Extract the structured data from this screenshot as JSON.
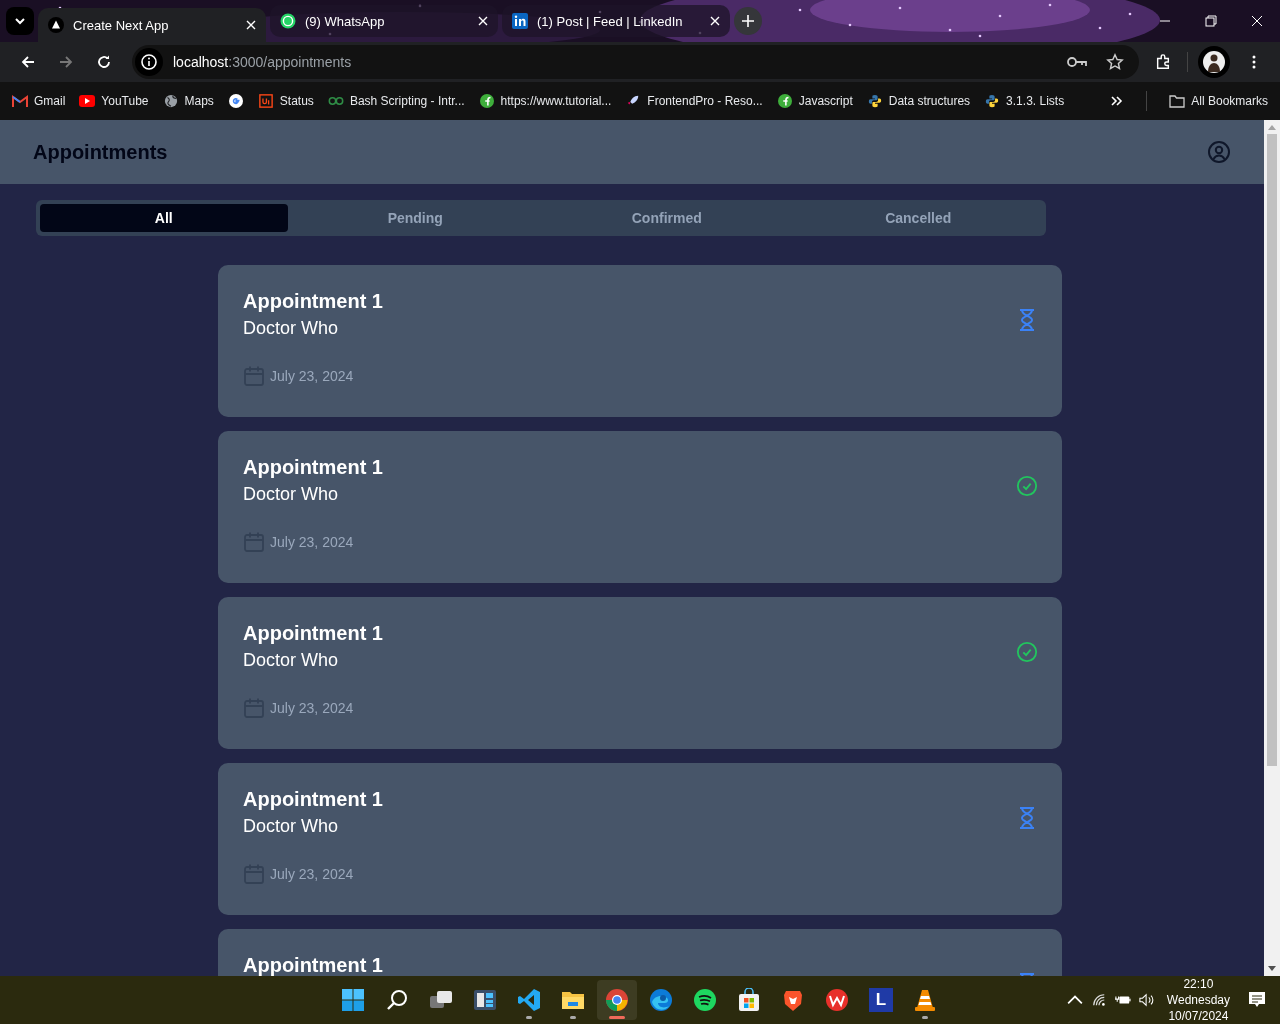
{
  "browser": {
    "tabs": [
      {
        "title": "Create Next App",
        "kind": "next",
        "selected": true
      },
      {
        "title": "(9) WhatsApp",
        "kind": "whatsapp",
        "selected": false
      },
      {
        "title": "(1) Post | Feed | LinkedIn",
        "kind": "linkedin",
        "selected": false
      }
    ],
    "address": {
      "host": "localhost",
      "path": ":3000/appointments"
    },
    "bookmarks": [
      {
        "label": "Gmail",
        "kind": "gmail"
      },
      {
        "label": "YouTube",
        "kind": "youtube"
      },
      {
        "label": "Maps",
        "kind": "globe"
      },
      {
        "kind": "google"
      },
      {
        "label": "Status",
        "kind": "ui"
      },
      {
        "label": "Bash Scripting - Intr...",
        "kind": "gfg"
      },
      {
        "label": "https://www.tutorial...",
        "kind": "leaf"
      },
      {
        "label": "FrontendPro - Reso...",
        "kind": "rocket"
      },
      {
        "label": "Javascript",
        "kind": "leaf"
      },
      {
        "label": "Data structures",
        "kind": "python"
      },
      {
        "label": "3.1.3. Lists",
        "kind": "python"
      }
    ],
    "all_bookmarks": "All Bookmarks"
  },
  "app": {
    "title": "Appointments",
    "filters": [
      {
        "label": "All",
        "selected": true
      },
      {
        "label": "Pending",
        "selected": false
      },
      {
        "label": "Confirmed",
        "selected": false
      },
      {
        "label": "Cancelled",
        "selected": false
      }
    ],
    "appointments": [
      {
        "title": "Appointment 1",
        "doctor": "Doctor Who",
        "date": "July 23, 2024",
        "kind": "pending"
      },
      {
        "title": "Appointment 1",
        "doctor": "Doctor Who",
        "date": "July 23, 2024",
        "kind": "confirmed"
      },
      {
        "title": "Appointment 1",
        "doctor": "Doctor Who",
        "date": "July 23, 2024",
        "kind": "confirmed"
      },
      {
        "title": "Appointment 1",
        "doctor": "Doctor Who",
        "date": "July 23, 2024",
        "kind": "pending"
      },
      {
        "title": "Appointment 1",
        "kind": "pending"
      }
    ]
  },
  "taskbar": {
    "apps": [
      {
        "kind": "start",
        "running": false,
        "active": false
      },
      {
        "kind": "search",
        "running": false,
        "active": false
      },
      {
        "kind": "taskview",
        "running": false,
        "active": false
      },
      {
        "kind": "widgets",
        "running": false,
        "active": false
      },
      {
        "kind": "vscode",
        "running": true,
        "active": false
      },
      {
        "kind": "explorer",
        "running": true,
        "active": false
      },
      {
        "kind": "chrome",
        "running": true,
        "active": true
      },
      {
        "kind": "edge",
        "running": false,
        "active": false
      },
      {
        "kind": "spotify",
        "running": false,
        "active": false
      },
      {
        "kind": "store",
        "running": false,
        "active": false
      },
      {
        "kind": "brave",
        "running": false,
        "active": false
      },
      {
        "kind": "wps",
        "running": false,
        "active": false
      },
      {
        "kind": "letter",
        "label": "L",
        "running": false,
        "active": false
      },
      {
        "kind": "vlc",
        "running": true,
        "active": false
      }
    ],
    "clock": {
      "time": "22:10",
      "day": "Wednesday",
      "date": "10/07/2024"
    }
  }
}
